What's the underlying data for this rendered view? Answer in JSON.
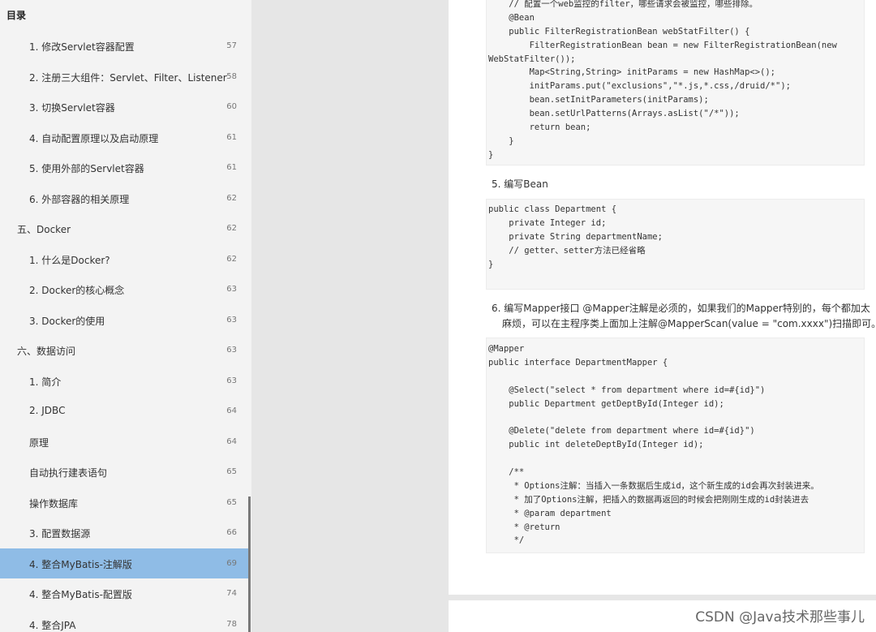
{
  "toc": {
    "title": "目录",
    "items": [
      {
        "label": "1. 修改Servlet容器配置",
        "page": "57",
        "level": 2
      },
      {
        "label": "2. 注册三大组件：Servlet、Filter、Listener",
        "page": "58",
        "level": 2
      },
      {
        "label": "3. 切换Servlet容器",
        "page": "60",
        "level": 2
      },
      {
        "label": "4. 自动配置原理以及启动原理",
        "page": "61",
        "level": 2
      },
      {
        "label": "5. 使用外部的Servlet容器",
        "page": "61",
        "level": 2
      },
      {
        "label": "6. 外部容器的相关原理",
        "page": "62",
        "level": 2
      },
      {
        "label": "五、Docker",
        "page": "62",
        "level": 1
      },
      {
        "label": "1. 什么是Docker?",
        "page": "62",
        "level": 2
      },
      {
        "label": "2. Docker的核心概念",
        "page": "63",
        "level": 2
      },
      {
        "label": "3. Docker的使用",
        "page": "63",
        "level": 2
      },
      {
        "label": "六、数据访问",
        "page": "63",
        "level": 1
      },
      {
        "label": "1. 简介",
        "page": "63",
        "level": 2
      },
      {
        "label": "2. JDBC",
        "page": "64",
        "level": 2
      },
      {
        "label": "原理",
        "page": "64",
        "level": 2
      },
      {
        "label": "自动执行建表语句",
        "page": "65",
        "level": 2
      },
      {
        "label": "操作数据库",
        "page": "65",
        "level": 2
      },
      {
        "label": "3. 配置数据源",
        "page": "66",
        "level": 2
      },
      {
        "label": "4. 整合MyBatis-注解版",
        "page": "69",
        "level": 2,
        "active": true
      },
      {
        "label": "4. 整合MyBatis-配置版",
        "page": "74",
        "level": 2
      },
      {
        "label": "4. 整合JPA",
        "page": "78",
        "level": 2
      }
    ]
  },
  "doc": {
    "code1": [
      "    // 配置一个web监控的filter，哪些请求会被监控，哪些排除。",
      "    @Bean",
      "    public FilterRegistrationBean webStatFilter() {",
      "        FilterRegistrationBean bean = new FilterRegistrationBean(new",
      "WebStatFilter());",
      "        Map<String,String> initParams = new HashMap<>();",
      "        initParams.put(\"exclusions\",\"*.js,*.css,/druid/*\");",
      "        bean.setInitParameters(initParams);",
      "        bean.setUrlPatterns(Arrays.asList(\"/*\"));",
      "        return bean;",
      "    }",
      "}"
    ],
    "step5": "5. 编写Bean",
    "code2": [
      "public class Department {",
      "    private Integer id;",
      "    private String departmentName;",
      "    // getter、setter方法已经省略",
      "}"
    ],
    "step6_line1": "6. 编写Mapper接口 @Mapper注解是必须的，如果我们的Mapper特别的，每个都加太",
    "step6_line2": "麻烦，可以在主程序类上面加上注解@MapperScan(value = \"com.xxxx\")扫描即可。",
    "code3": [
      "@Mapper",
      "public interface DepartmentMapper {",
      "",
      "    @Select(\"select * from department where id=#{id}\")",
      "    public Department getDeptById(Integer id);",
      "",
      "    @Delete(\"delete from department where id=#{id}\")",
      "    public int deleteDeptById(Integer id);",
      "",
      "    /**",
      "     * Options注解：当插入一条数据后生成id，这个新生成的id会再次封装进来。",
      "     * 加了Options注解，把插入的数据再返回的时候会把刚刚生成的id封装进去",
      "     * @param department",
      "     * @return",
      "     */"
    ]
  },
  "watermark": "CSDN @Java技术那些事儿"
}
